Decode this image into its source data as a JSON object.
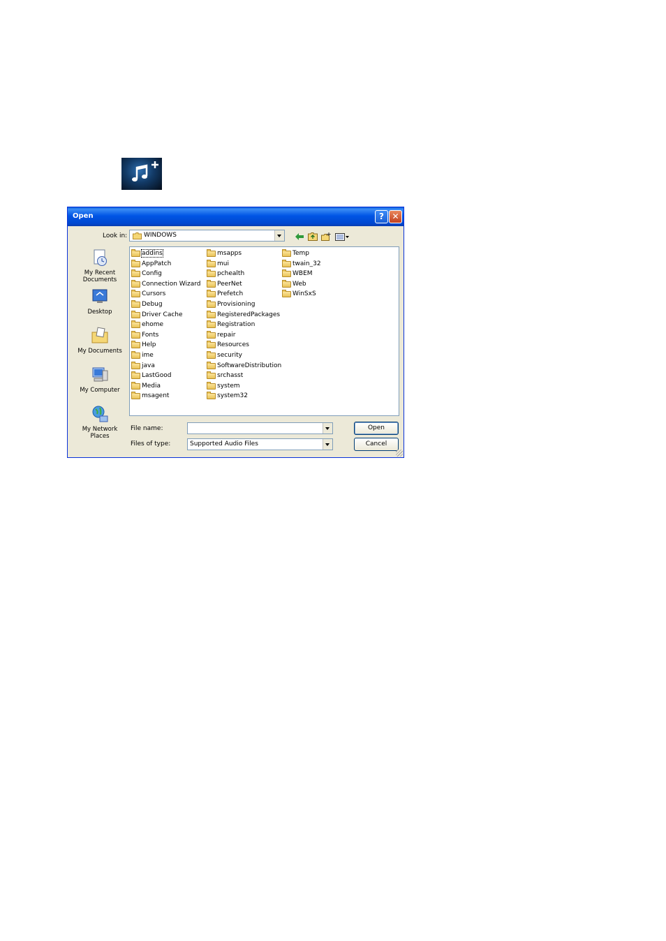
{
  "dialog": {
    "title": "Open",
    "help_glyph": "?",
    "close_glyph": "✕",
    "look_in_label": "Look in:",
    "look_in_value": "WINDOWS",
    "file_name_label": "File name:",
    "file_name_value": "",
    "files_of_type_label": "Files of type:",
    "files_of_type_value": "Supported Audio Files",
    "open_button": "Open",
    "cancel_button": "Cancel"
  },
  "places": [
    {
      "label": "My Recent Documents",
      "icon": "recent-documents-icon"
    },
    {
      "label": "Desktop",
      "icon": "desktop-icon"
    },
    {
      "label": "My Documents",
      "icon": "my-documents-icon"
    },
    {
      "label": "My Computer",
      "icon": "my-computer-icon"
    },
    {
      "label": "My Network Places",
      "icon": "network-places-icon"
    }
  ],
  "folders": {
    "col1": [
      "addins",
      "AppPatch",
      "Config",
      "Connection Wizard",
      "Cursors",
      "Debug",
      "Driver Cache",
      "ehome",
      "Fonts",
      "Help",
      "ime",
      "java",
      "LastGood",
      "Media",
      "msagent"
    ],
    "col2": [
      "msapps",
      "mui",
      "pchealth",
      "PeerNet",
      "Prefetch",
      "Provisioning",
      "RegisteredPackages",
      "Registration",
      "repair",
      "Resources",
      "security",
      "SoftwareDistribution",
      "srchasst",
      "system",
      "system32"
    ],
    "col3": [
      "Temp",
      "twain_32",
      "WBEM",
      "Web",
      "WinSxS"
    ]
  },
  "colors": {
    "titlebar": "#0055e5",
    "dialog_bg": "#ece9d8",
    "border": "#7f9db9"
  }
}
